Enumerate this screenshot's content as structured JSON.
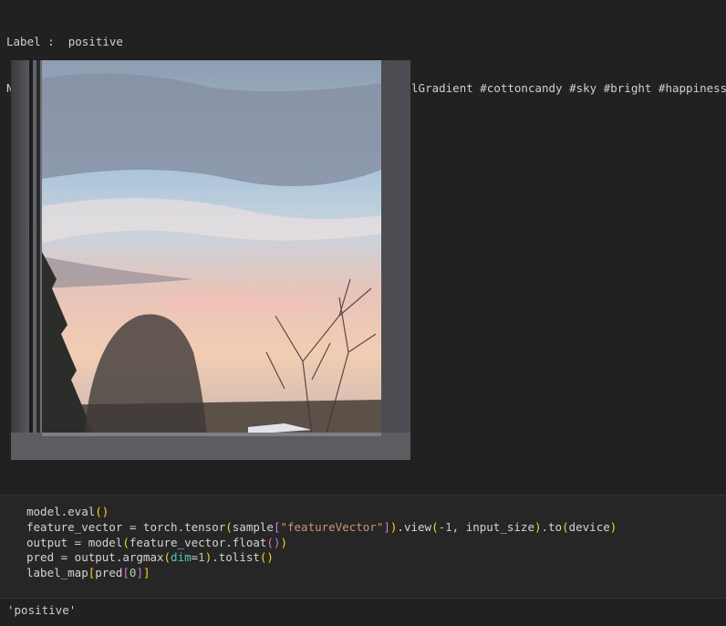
{
  "output": {
    "label_line": "Label :  positive",
    "caption_line": "Nothin but the pastel sky hangin over you and I #theOriginalGradient #cottoncandy #sky #bright #happiness"
  },
  "image": {
    "description_icon": "photo-sky-window"
  },
  "code": {
    "l1_a": "model.eval",
    "l2_a": "feature_vector = torch.tensor",
    "l2_b": "sample",
    "l2_c": "\"featureVector\"",
    "l2_d": ".view",
    "l2_e": "-1",
    "l2_f": ", input_size",
    "l2_g": ".to",
    "l2_h": "device",
    "l3_a": "output = model",
    "l3_b": "feature_vector.float",
    "l4_a": "pred = output.argmax",
    "l4_b": "dim",
    "l4_c": "=",
    "l4_d": "1",
    "l4_e": ".tolist",
    "l5_a": "label_map",
    "l5_b": "pred",
    "l5_c": "0"
  },
  "result": {
    "value": "'positive'"
  }
}
